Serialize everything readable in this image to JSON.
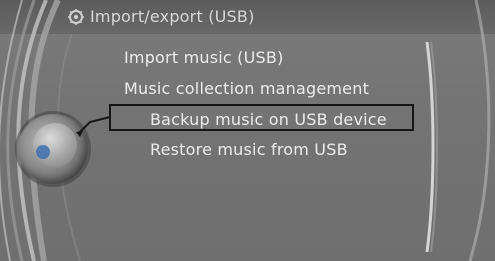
{
  "header": {
    "title": "Import/export (USB)",
    "icon": "settings-gear-icon"
  },
  "menu": {
    "items": [
      {
        "label": "Import music (USB)"
      },
      {
        "label": "Music collection management"
      },
      {
        "label": "Backup music on USB device",
        "selected": true
      },
      {
        "label": "Restore music from USB"
      }
    ]
  },
  "colors": {
    "background": "#747474",
    "text": "#ececec",
    "highlight_border": "#161616",
    "controller_dot": "#3f6fb0"
  }
}
